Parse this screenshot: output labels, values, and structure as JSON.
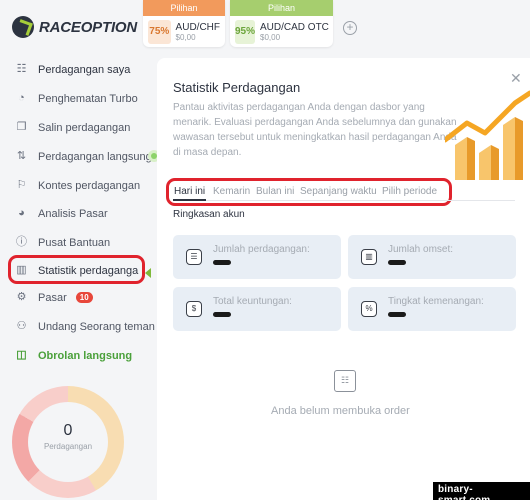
{
  "brand": {
    "race": "RACE",
    "option": "OPTION"
  },
  "assets": [
    {
      "header": "Pilihan",
      "pct": "75%",
      "name": "AUD/CHF",
      "value": "$0,00",
      "color": "#f29a5c",
      "pct_bg": "#fbe6d6",
      "pct_color": "#d9772f"
    },
    {
      "header": "Pilihan",
      "pct": "95%",
      "name": "AUD/CAD OTC",
      "value": "$0,00",
      "color": "#a6ce6e",
      "pct_bg": "#e7f3d7",
      "pct_color": "#6ba43a"
    }
  ],
  "add_symbol": "+",
  "sidebar": {
    "items": [
      {
        "label": "Perdagangan saya"
      },
      {
        "label": "Penghematan Turbo"
      },
      {
        "label": "Salin perdagangan"
      },
      {
        "label": "Perdagangan langsung"
      },
      {
        "label": "Kontes perdagangan"
      },
      {
        "label": "Analisis Pasar"
      },
      {
        "label": "Pusat Bantuan"
      },
      {
        "label": "Statistik perdaganga"
      },
      {
        "label": "Pasar",
        "badge": "10"
      },
      {
        "label": "Undang Seorang teman"
      },
      {
        "label": "Obrolan langsung"
      }
    ]
  },
  "donut": {
    "count": "0",
    "label": "Perdagangan"
  },
  "panel": {
    "title": "Statistik Perdagangan",
    "description": "Pantau aktivitas perdagangan Anda dengan dasbor yang menarik. Evaluasi perdagangan Anda sebelumnya dan gunakan wawasan tersebut untuk meningkatkan hasil perdagangan Anda di masa depan.",
    "close": "✕",
    "tabs": [
      {
        "label": "Hari ini"
      },
      {
        "label": "Kemarin"
      },
      {
        "label": "Bulan ini"
      },
      {
        "label": "Sepanjang waktu"
      },
      {
        "label": "Pilih periode"
      }
    ],
    "summary_title": "Ringkasan akun",
    "cards": [
      {
        "label": "Jumlah perdagangan:",
        "icon": "list-icon"
      },
      {
        "label": "Jumlah omset:",
        "icon": "bar-chart-icon"
      },
      {
        "label": "Total keuntungan:",
        "icon": "dollar-icon"
      },
      {
        "label": "Tingkat kemenangan:",
        "icon": "percent-icon"
      }
    ],
    "empty_text": "Anda belum membuka order"
  },
  "watermark": "binary-smart.com",
  "colors": {
    "accent_green": "#4aa03a",
    "badge_red": "#e8473b",
    "highlight_red": "#e0232d",
    "chart_orange": "#f5a623"
  }
}
